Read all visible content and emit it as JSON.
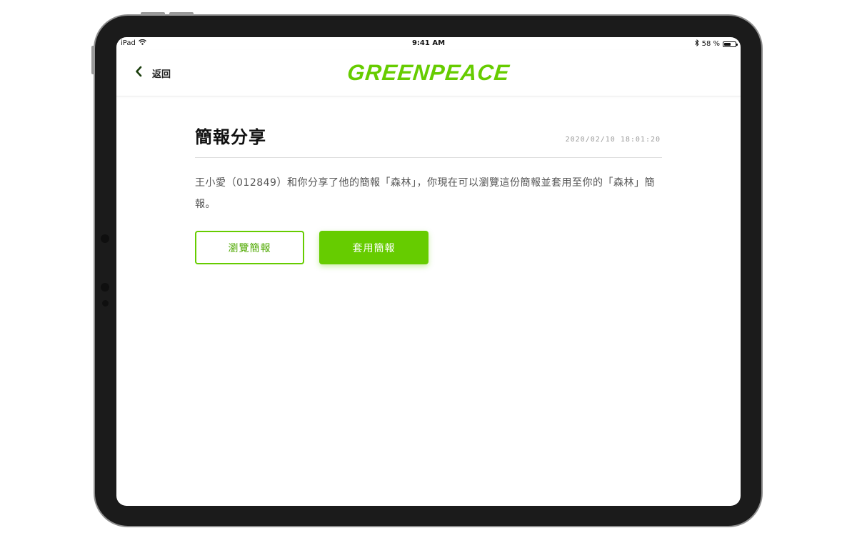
{
  "status_bar": {
    "device": "iPad",
    "time": "9:41 AM",
    "battery_text": "58 %",
    "battery_level": 0.58
  },
  "nav": {
    "back_label": "返回",
    "logo_text": "GREENPEACE"
  },
  "notification": {
    "title": "簡報分享",
    "timestamp": "2020/02/10 18:01:20",
    "message": "王小愛（012849）和你分享了他的簡報「森林」，你現在可以瀏覽這份簡報並套用至你的「森林」簡報。"
  },
  "actions": {
    "browse_label": "瀏覽簡報",
    "apply_label": "套用簡報"
  },
  "colors": {
    "brand_green": "#66cc00"
  }
}
